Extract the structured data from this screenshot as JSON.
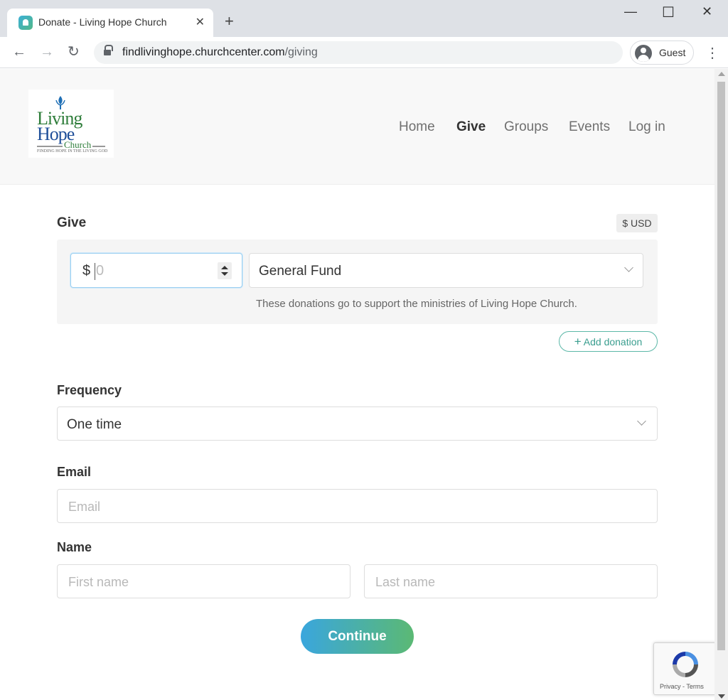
{
  "browser": {
    "tab_title": "Donate - Living Hope Church",
    "tab_close": "✕",
    "new_tab": "+",
    "url_host": "findlivinghope.churchcenter.com",
    "url_path": "/giving",
    "profile_label": "Guest",
    "window_controls": {
      "minimize": "—",
      "maximize": "☐",
      "close": "✕"
    },
    "nav": {
      "back": "←",
      "forward": "→",
      "reload": "↻",
      "menu": "⋮"
    }
  },
  "site": {
    "logo": {
      "line1": "Living",
      "line2": "Hope",
      "line3": "Church",
      "tagline": "FINDING HOPE IN THE LIVING GOD"
    },
    "nav": [
      {
        "label": "Home",
        "active": false
      },
      {
        "label": "Give",
        "active": true
      },
      {
        "label": "Groups",
        "active": false
      },
      {
        "label": "Events",
        "active": false
      },
      {
        "label": "Log in",
        "active": false
      }
    ]
  },
  "give": {
    "title": "Give",
    "currency": "$ USD",
    "amount_symbol": "$",
    "amount_placeholder": "0",
    "fund": "General Fund",
    "fund_description": "These donations go to support the ministries of Living Hope Church.",
    "add_donation": "Add donation",
    "add_icon": "+"
  },
  "frequency": {
    "label": "Frequency",
    "value": "One time"
  },
  "email": {
    "label": "Email",
    "placeholder": "Email"
  },
  "name": {
    "label": "Name",
    "first_placeholder": "First name",
    "last_placeholder": "Last name"
  },
  "continue_label": "Continue",
  "recaptcha": {
    "links": "Privacy - Terms"
  },
  "colors": {
    "accent_teal": "#3a9e8f",
    "button_gradient_start": "#3aa6dd",
    "button_gradient_end": "#5bb974",
    "logo_green": "#2e7d3a",
    "logo_blue": "#1f4f99"
  }
}
